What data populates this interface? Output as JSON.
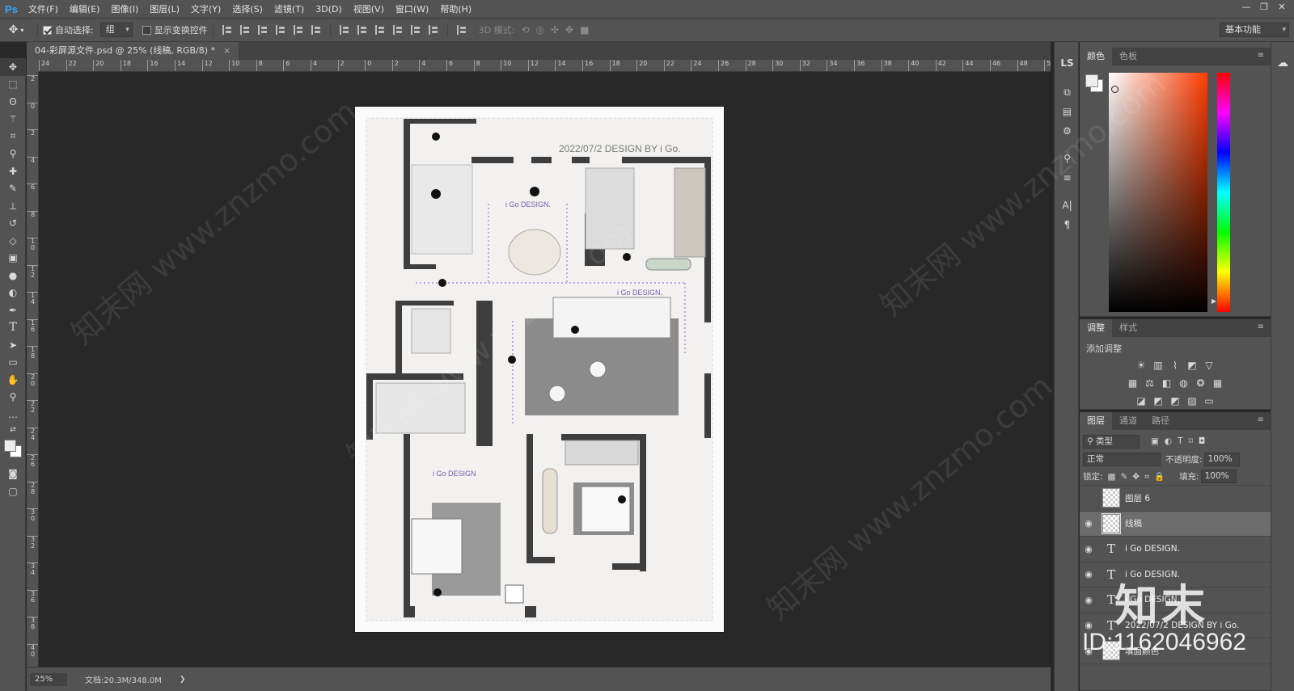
{
  "app": {
    "logo": "Ps"
  },
  "menu": [
    "文件(F)",
    "编辑(E)",
    "图像(I)",
    "图层(L)",
    "文字(Y)",
    "选择(S)",
    "滤镜(T)",
    "3D(D)",
    "视图(V)",
    "窗口(W)",
    "帮助(H)"
  ],
  "window_controls": {
    "minimize": "—",
    "restore": "❐",
    "close": "✕"
  },
  "options": {
    "auto_select_label": "自动选择:",
    "auto_select_value": "组",
    "show_transform_label": "显示变换控件",
    "mode_3d_label": "3D 模式:",
    "workspace": "基本功能"
  },
  "document": {
    "tab_title": "04-彩屏源文件.psd @ 25% (线稿, RGB/8) *",
    "close": "×",
    "plan_title": "2022/07/2 DESIGN BY i Go.",
    "design_labels": [
      "i Go DESIGN.",
      "i Go DESIGN.",
      "i Go DESIGN"
    ]
  },
  "ruler_h": [
    "24",
    "22",
    "20",
    "18",
    "16",
    "14",
    "12",
    "10",
    "8",
    "6",
    "4",
    "2",
    "0",
    "2",
    "4",
    "6",
    "8",
    "10",
    "12",
    "14",
    "16",
    "18",
    "20",
    "22",
    "24",
    "26",
    "28",
    "30",
    "32",
    "34",
    "36",
    "38",
    "40",
    "42",
    "44",
    "46",
    "48",
    "50",
    "52"
  ],
  "ruler_v": [
    "2",
    "0",
    "2",
    "4",
    "6",
    "8",
    "1 0",
    "1 2",
    "1 4",
    "1 6",
    "1 8",
    "2 0",
    "2 2",
    "2 4",
    "2 6",
    "2 8",
    "3 0",
    "3 2",
    "3 4",
    "3 6",
    "3 8",
    "4 0"
  ],
  "status": {
    "zoom": "25%",
    "doc_size": "文档:20.3M/348.0M",
    "arrow": "❯"
  },
  "panels": {
    "color": {
      "tabs": [
        "颜色",
        "色板"
      ]
    },
    "adjust": {
      "tabs": [
        "调整",
        "样式"
      ],
      "add_label": "添加调整"
    },
    "layers": {
      "tabs": [
        "图层",
        "通道",
        "路径"
      ],
      "filter_kind": "类型",
      "blend_mode": "正常",
      "opacity_label": "不透明度:",
      "opacity": "100%",
      "lock_label": "锁定:",
      "fill_label": "填充:",
      "fill": "100%",
      "rows": [
        {
          "name": "图层 6",
          "kind": "pixel",
          "visible": false,
          "selected": false
        },
        {
          "name": "线稿",
          "kind": "pixel",
          "visible": true,
          "selected": true
        },
        {
          "name": "i Go DESIGN.",
          "kind": "text",
          "visible": true,
          "selected": false
        },
        {
          "name": "i Go DESIGN.",
          "kind": "text",
          "visible": true,
          "selected": false
        },
        {
          "name": "i Go DESIGN.",
          "kind": "text",
          "visible": true,
          "selected": false
        },
        {
          "name": "2022/07/2 DESIGN BY i Go.",
          "kind": "text",
          "visible": true,
          "selected": false
        },
        {
          "name": "填面颜色",
          "kind": "pixel",
          "visible": true,
          "selected": false
        }
      ]
    }
  },
  "watermarks": {
    "site": "知末网 www.znzmo.com",
    "logo": "知末",
    "id": "ID:1162046962"
  }
}
